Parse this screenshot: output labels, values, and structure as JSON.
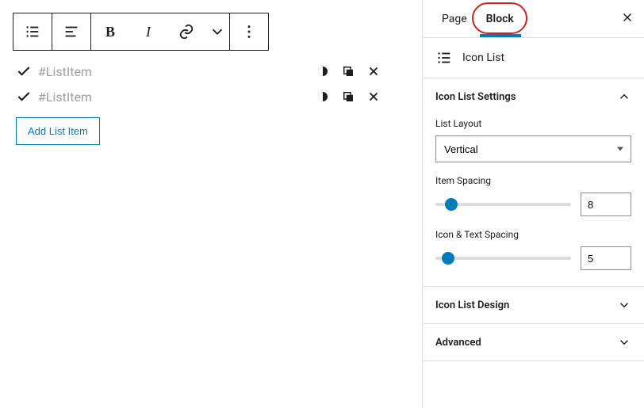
{
  "toolbar": {
    "bold": "B",
    "italic": "I"
  },
  "list": {
    "items": [
      {
        "text": "#ListItem"
      },
      {
        "text": "#ListItem"
      }
    ],
    "add_label": "Add List Item"
  },
  "sidebar": {
    "tabs": {
      "page": "Page",
      "block": "Block"
    },
    "block_name": "Icon List",
    "panels": {
      "settings": {
        "title": "Icon List Settings",
        "layout_label": "List Layout",
        "layout_value": "Vertical",
        "item_spacing_label": "Item Spacing",
        "item_spacing_value": "8",
        "icon_text_spacing_label": "Icon & Text Spacing",
        "icon_text_spacing_value": "5"
      },
      "design": {
        "title": "Icon List Design"
      },
      "advanced": {
        "title": "Advanced"
      }
    }
  }
}
